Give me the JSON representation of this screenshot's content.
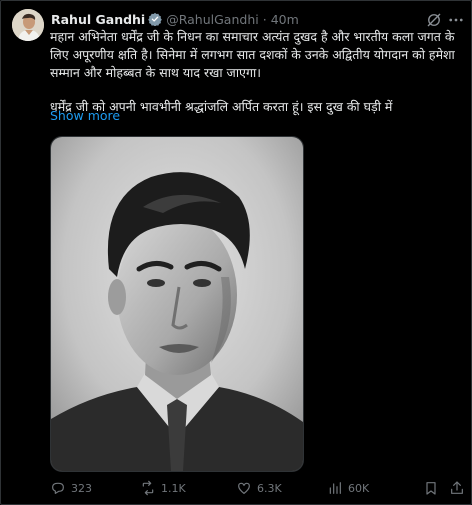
{
  "post": {
    "author_name": "Rahul Gandhi",
    "handle": "@RahulGandhi",
    "separator": "·",
    "time": "40m",
    "text_paragraph_1": "महान अभिनेता धर्मेंद्र जी के निधन का समाचार अत्यंत दुखद है और भारतीय कला जगत के लिए अपूरणीय क्षति है। सिनेमा में लगभग सात दशकों के उनके अद्वितीय योगदान को हमेशा सम्मान और मोहब्बत के साथ याद रखा जाएगा।",
    "text_paragraph_2": "धर्मेंद्र जी को अपनी भावभीनी श्रद्धांजलि अर्पित करता हूं। इस दुख की घड़ी में",
    "show_more": "Show more"
  },
  "actions": {
    "replies": "323",
    "reposts": "1.1K",
    "likes": "6.3K",
    "views": "60K"
  },
  "colors": {
    "background": "#000000",
    "text": "#e7e9ea",
    "muted": "#71767b",
    "link": "#1d9bf0",
    "border": "#2f3336"
  },
  "icons": [
    "grok-icon",
    "more-options-icon",
    "verified-badge-icon",
    "reply-icon",
    "repost-icon",
    "like-icon",
    "views-icon",
    "bookmark-icon",
    "share-icon"
  ]
}
